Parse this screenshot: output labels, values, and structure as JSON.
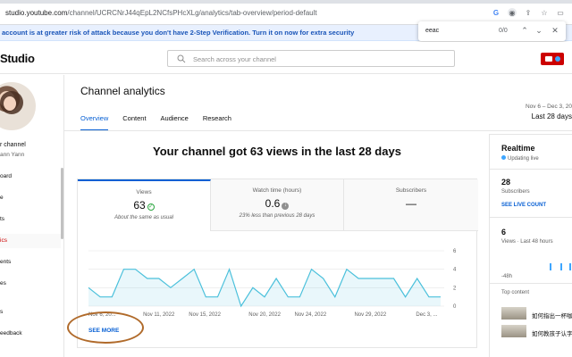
{
  "browser": {
    "url_host": "studio.youtube.com",
    "url_path": "/channel/UCRCNrJ44qEpL2NCfsPHcXLg/analytics/tab-overview/period-default"
  },
  "banner": {
    "text": "account is at greater risk of attack because you don't have 2-Step Verification. Turn it on now for extra security"
  },
  "find_bar": {
    "query": "eeac",
    "count": "0/0"
  },
  "header": {
    "logo": "Studio",
    "search_placeholder": "Search across your channel"
  },
  "sidebar": {
    "channel_name": "r channel",
    "channel_sub": "ann Yann",
    "items": [
      {
        "label": "oard"
      },
      {
        "label": "e"
      },
      {
        "label": "ts"
      },
      {
        "label": "ics",
        "active": true
      },
      {
        "label": "ents"
      },
      {
        "label": "es"
      },
      {
        "label": "s"
      },
      {
        "label": "eedback"
      }
    ]
  },
  "page": {
    "title": "Channel analytics",
    "tabs": [
      "Overview",
      "Content",
      "Audience",
      "Research"
    ],
    "date_range_small": "Nov 6 – Dec 3, 20",
    "date_range_label": "Last 28 days",
    "headline": "Your channel got 63 views in the last 28 days"
  },
  "metrics": [
    {
      "label": "Views",
      "value": "63",
      "note": "About the same as usual",
      "icon": "check-circle-icon"
    },
    {
      "label": "Watch time (hours)",
      "value": "0.6",
      "note": "23% less than previous 28 days",
      "icon": "down-arrow-icon"
    },
    {
      "label": "Subscribers",
      "value": "—",
      "note": ""
    }
  ],
  "see_more": "SEE MORE",
  "chart_data": {
    "type": "area",
    "x_tick_labels": [
      "Nov 6, 20...",
      "Nov 11, 2022",
      "Nov 15, 2022",
      "Nov 20, 2022",
      "Nov 24, 2022",
      "Nov 29, 2022",
      "Dec 3, ..."
    ],
    "y_ticks": [
      0,
      2,
      4,
      6
    ],
    "ylim": [
      0,
      6
    ],
    "series": [
      {
        "values": [
          2,
          1,
          1,
          4,
          4,
          3,
          3,
          2,
          3,
          4,
          1,
          1,
          4,
          0,
          2,
          1,
          3,
          1,
          1,
          4,
          3,
          1,
          4,
          3,
          3,
          3,
          3,
          1,
          3,
          1,
          1
        ]
      }
    ],
    "color": "#4ac0db",
    "grid": true
  },
  "realtime": {
    "title": "Realtime",
    "status": "Updating live",
    "subscribers_value": "28",
    "subscribers_label": "Subscribers",
    "live_count_link": "SEE LIVE COUNT",
    "views_value": "6",
    "views_label": "Views · Last 48 hours",
    "axis_label": "-48h",
    "top_content_label": "Top content",
    "top_content": [
      {
        "title": "如何指出一杯咖"
      },
      {
        "title": "如何教孩子认字"
      }
    ]
  }
}
